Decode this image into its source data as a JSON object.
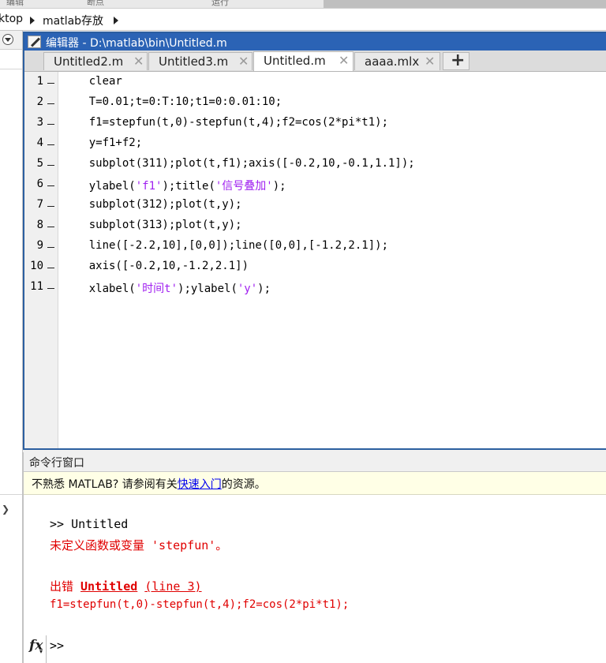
{
  "ribbon": {
    "labels": [
      "编辑",
      "断点",
      "运行"
    ]
  },
  "address": {
    "segments": [
      "ktop",
      "matlab存放"
    ]
  },
  "editor": {
    "title": "编辑器 - D:\\matlab\\bin\\Untitled.m",
    "tabs": [
      {
        "label": "Untitled2.m",
        "active": false
      },
      {
        "label": "Untitled3.m",
        "active": false
      },
      {
        "label": "Untitled.m",
        "active": true
      },
      {
        "label": "aaaa.mlx",
        "active": false
      }
    ],
    "close_glyph": "✕",
    "add_tab_glyph": "+",
    "lines": [
      {
        "n": "1",
        "pre": "    clear",
        "str": "",
        "post": ""
      },
      {
        "n": "2",
        "pre": "    T=0.01;t=0:T:10;t1=0:0.01:10;",
        "str": "",
        "post": ""
      },
      {
        "n": "3",
        "pre": "    f1=stepfun(t,0)-stepfun(t,4);f2=cos(2*pi*t1);",
        "str": "",
        "post": ""
      },
      {
        "n": "4",
        "pre": "    y=f1+f2;",
        "str": "",
        "post": ""
      },
      {
        "n": "5",
        "pre": "    subplot(311);plot(t,f1);axis([-0.2,10,-0.1,1.1]);",
        "str": "",
        "post": ""
      },
      {
        "n": "6",
        "pre": "    ylabel(",
        "str": "'f1'",
        "post": ");title(",
        "str2": "'信号叠加'",
        "post2": ");"
      },
      {
        "n": "7",
        "pre": "    subplot(312);plot(t,y);",
        "str": "",
        "post": ""
      },
      {
        "n": "8",
        "pre": "    subplot(313);plot(t,y);",
        "str": "",
        "post": ""
      },
      {
        "n": "9",
        "pre": "    line([-2.2,10],[0,0]);line([0,0],[-1.2,2.1]);",
        "str": "",
        "post": ""
      },
      {
        "n": "10",
        "pre": "    axis([-0.2,10,-1.2,2.1])",
        "str": "",
        "post": ""
      },
      {
        "n": "11",
        "pre": "    xlabel(",
        "str": "'时间t'",
        "post": ");ylabel(",
        "str2": "'y'",
        "post2": ");"
      }
    ]
  },
  "command_window": {
    "title": "命令行窗口",
    "notice_prefix": "不熟悉 MATLAB? 请参阅有关",
    "notice_link": "快速入门",
    "notice_suffix": "的资源。",
    "history_cmd": ">> Untitled",
    "error_msg": "未定义函数或变量 'stepfun'。",
    "error_prefix": "出错 ",
    "error_file": "Untitled",
    "error_line": "(line 3)",
    "error_code": "f1=stepfun(t,0)-stepfun(t,4);f2=cos(2*pi*t1);",
    "prompt": ">>",
    "fx_label": "fx"
  },
  "colors": {
    "editor_titlebar": "#2b63b5",
    "string": "#a020f0",
    "error": "#e00000",
    "link": "#0000ee",
    "notice_bg": "#ffffe6"
  }
}
